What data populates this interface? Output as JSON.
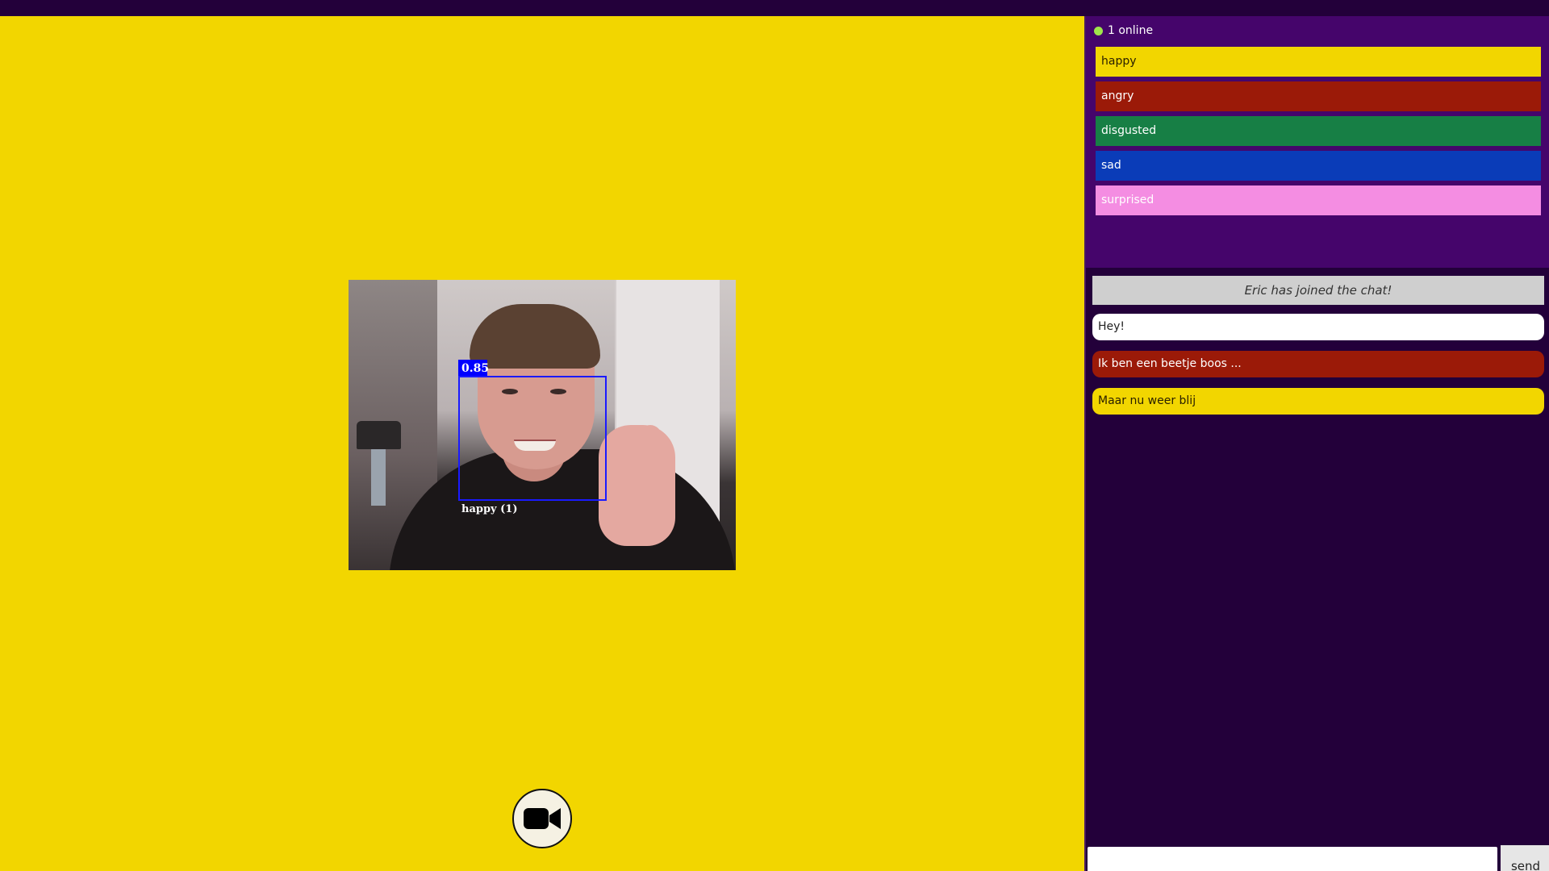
{
  "video": {
    "detection_score": "0.85",
    "detection_label": "happy (1)"
  },
  "camera_button": {
    "icon": "video-camera-icon"
  },
  "sidebar": {
    "online_text": "1 online",
    "online_color": "#9fe64b",
    "emotions": [
      {
        "label": "happy",
        "color": "#f2d600",
        "text_color": "#2a2000"
      },
      {
        "label": "angry",
        "color": "#9b1a08",
        "text_color": "#ffffff"
      },
      {
        "label": "disgusted",
        "color": "#177f45",
        "text_color": "#ffffff"
      },
      {
        "label": "sad",
        "color": "#0a3cb8",
        "text_color": "#ffffff"
      },
      {
        "label": "surprised",
        "color": "#f48de2",
        "text_color": "#ffffff"
      }
    ]
  },
  "chat": {
    "system_message": "Eric has joined the chat!",
    "messages": [
      {
        "text": "Hey!",
        "color": "#ffffff",
        "text_color": "#222222"
      },
      {
        "text": "Ik ben een beetje boos ...",
        "color": "#9b1a08",
        "text_color": "#ffffff"
      },
      {
        "text": "Maar nu weer blij",
        "color": "#f2d600",
        "text_color": "#2a2000"
      }
    ]
  },
  "composer": {
    "input_value": "",
    "send_label": "send"
  }
}
